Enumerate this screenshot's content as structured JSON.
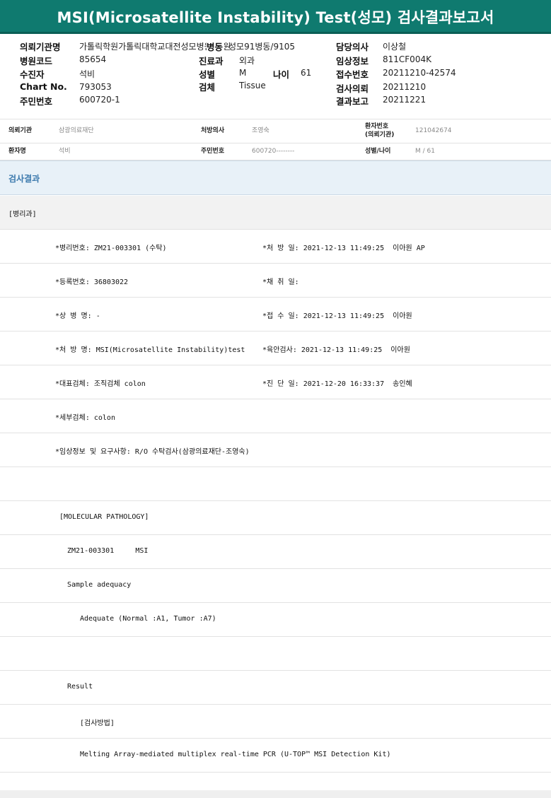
{
  "title": "MSI(Microsatellite Instability) Test(성모) 검사결과보고서",
  "header": {
    "col1": [
      {
        "label": "의뢰기관명",
        "value": "가톨릭학원가톨릭대학교대전성모병원(병원"
      },
      {
        "label": "병원코드",
        "value": "85654"
      },
      {
        "label": "수진자",
        "value": "석비"
      },
      {
        "label": "Chart No.",
        "value": "793053"
      },
      {
        "label": "주민번호",
        "value": "600720-1"
      }
    ],
    "col2": [
      {
        "label": "병동",
        "value": "성모91병동/9105"
      },
      {
        "label": "진료과",
        "value": "외과"
      },
      {
        "label": "성별",
        "value": "M"
      },
      {
        "label": "검체",
        "value": "Tissue"
      }
    ],
    "age": {
      "label": "나이",
      "value": "61"
    },
    "col3": [
      {
        "label": "담당의사",
        "value": "이상철"
      },
      {
        "label": "임상정보",
        "value": "811CF004K"
      },
      {
        "label": "접수번호",
        "value": "20211210-42574"
      },
      {
        "label": "검사의뢰",
        "value": "20211210"
      },
      {
        "label": "결과보고",
        "value": "20211221"
      }
    ]
  },
  "patient": {
    "row1": {
      "l1": "의뢰기관",
      "v1": "삼광의료재단",
      "l2": "처방의사",
      "v2": "조영숙",
      "l3a": "환자번호",
      "l3b": "(의뢰기관)",
      "v3": "121042674"
    },
    "row2": {
      "l1": "환자명",
      "v1": "석비",
      "l2": "주민번호",
      "v2": "600720--------",
      "l3": "성별/나이",
      "v3": "M / 61"
    }
  },
  "section_title": "검사결과",
  "dept": "[병리과]",
  "details": {
    "pathology_no": "*병리번호: ZM21-003301 (수탁)",
    "order_date": "*처 방 일: 2021-12-13 11:49:25  이아원 AP",
    "reg_no": "*등록번호: 36803022",
    "collect_date": "*채 취 일:",
    "disease": "*상 병 명: -",
    "receipt_date": "*접 수 일: 2021-12-13 11:49:25  이아원",
    "order_name": "*처 방 명: MSI(Microsatellite Instability)test",
    "gross_exam": "*육안검사: 2021-12-13 11:49:25  이아원",
    "specimen": "*대표검체: 조직검체 colon",
    "diagnosis_date": "*진 단 일: 2021-12-20 16:33:37  송인혜",
    "sub_specimen": "*세부검체: colon",
    "clinical_info": "*임상정보 및 요구사항: R/O 수탁검사(삼광의료재단-조영숙)"
  },
  "report": {
    "heading": "[MOLECULAR PATHOLOGY]",
    "case": "ZM21-003301     MSI",
    "adequacy_label": "Sample adequacy",
    "adequacy_value": "Adequate (Normal :A1, Tumor :A7)",
    "result_label": "Result",
    "method_label": "[검사방법]",
    "method_value": "Melting Array-mediated multiplex real-time PCR (U-TOP™ MSI Detection Kit)"
  }
}
